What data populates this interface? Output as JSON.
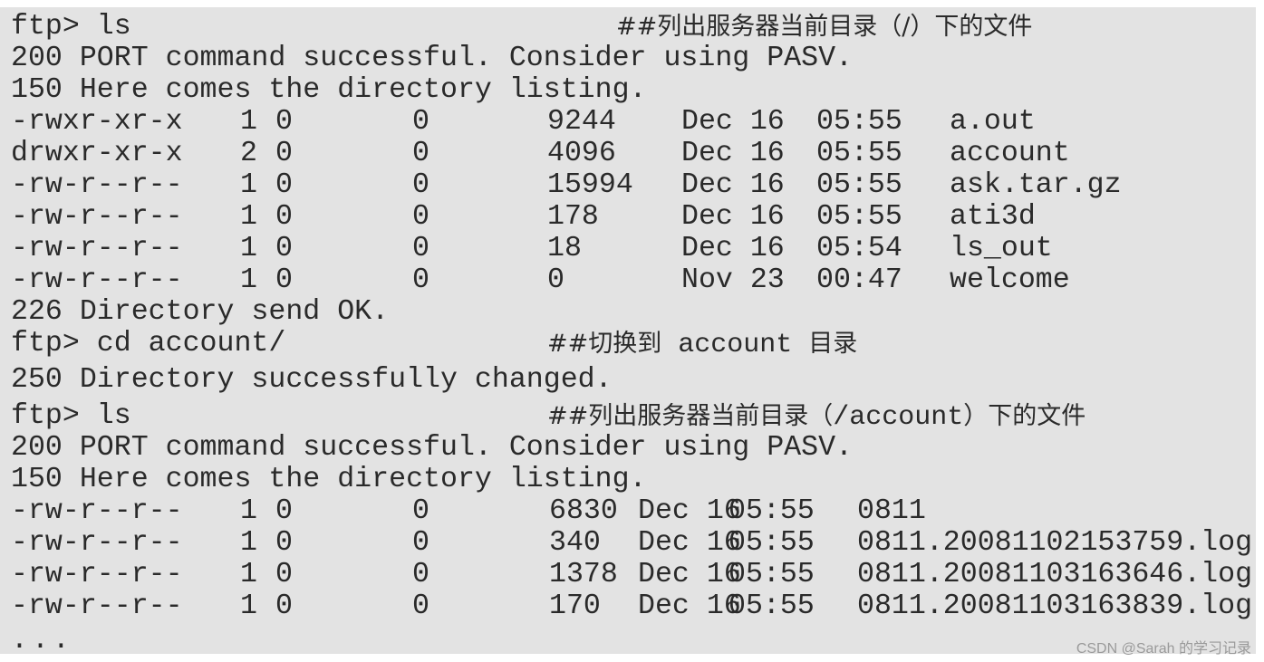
{
  "session": {
    "lines": [
      {
        "text": "ftp> ls",
        "comment": "##列出服务器当前目录（/）下的文件"
      },
      {
        "text": "200 PORT command successful. Consider using PASV."
      },
      {
        "text": "150 Here comes the directory listing."
      }
    ],
    "listing1": [
      {
        "perms": "-rwxr-xr-x",
        "links": "1",
        "owner": "0",
        "group": "0",
        "size": "9244",
        "date": "Dec 16",
        "time": "05:55",
        "name": "a.out"
      },
      {
        "perms": "drwxr-xr-x",
        "links": "2",
        "owner": "0",
        "group": "0",
        "size": "4096",
        "date": "Dec 16",
        "time": "05:55",
        "name": "account"
      },
      {
        "perms": "-rw-r--r--",
        "links": "1",
        "owner": "0",
        "group": "0",
        "size": "15994",
        "date": "Dec 16",
        "time": "05:55",
        "name": "ask.tar.gz"
      },
      {
        "perms": "-rw-r--r--",
        "links": "1",
        "owner": "0",
        "group": "0",
        "size": "178",
        "date": "Dec 16",
        "time": "05:55",
        "name": "ati3d"
      },
      {
        "perms": "-rw-r--r--",
        "links": "1",
        "owner": "0",
        "group": "0",
        "size": "18",
        "date": "Dec 16",
        "time": "05:54",
        "name": "ls_out"
      },
      {
        "perms": "-rw-r--r--",
        "links": "1",
        "owner": "0",
        "group": "0",
        "size": "0",
        "date": "Nov 23",
        "time": "00:47",
        "name": "welcome"
      }
    ],
    "after1": [
      {
        "text": "226 Directory send OK."
      },
      {
        "text": "ftp> cd account/",
        "comment_pre": "##切换到",
        "comment_mono": " account ",
        "comment_post": "目录"
      },
      {
        "text": "250 Directory successfully changed."
      },
      {
        "text": "ftp> ls",
        "comment_pre": "##列出服务器当前目录（",
        "comment_mono": "/account",
        "comment_post": "）下的文件"
      },
      {
        "text": "200 PORT command successful. Consider using PASV."
      },
      {
        "text": "150 Here comes the directory listing."
      }
    ],
    "listing2": [
      {
        "perms": "-rw-r--r--",
        "links": "1",
        "owner": "0",
        "group": "0",
        "size": "6830",
        "date": "Dec 16",
        "time": "05:55",
        "name": "0811"
      },
      {
        "perms": "-rw-r--r--",
        "links": "1",
        "owner": "0",
        "group": "0",
        "size": "340",
        "date": "Dec 16",
        "time": "05:55",
        "name": "0811.20081102153759.log"
      },
      {
        "perms": "-rw-r--r--",
        "links": "1",
        "owner": "0",
        "group": "0",
        "size": "1378",
        "date": "Dec 16",
        "time": "05:55",
        "name": "0811.20081103163646.log"
      },
      {
        "perms": "-rw-r--r--",
        "links": "1",
        "owner": "0",
        "group": "0",
        "size": "170",
        "date": "Dec 16",
        "time": "05:55",
        "name": "0811.20081103163839.log"
      }
    ],
    "ellipsis": "..."
  },
  "watermark": "CSDN @Sarah 的学习记录"
}
